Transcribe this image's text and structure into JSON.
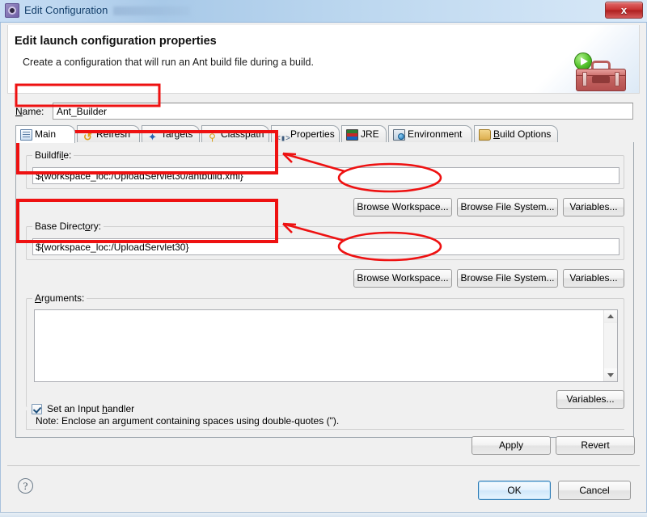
{
  "window": {
    "title": "Edit Configuration",
    "icon": "gear-window-icon",
    "close_label": "x"
  },
  "banner": {
    "title": "Edit launch configuration properties",
    "subtitle": "Create a configuration that will run an Ant build file during a build.",
    "icon": "toolbox-with-run-badge-icon"
  },
  "name": {
    "label": "Name:",
    "value": "Ant_Builder"
  },
  "tabs": [
    {
      "label": "Main",
      "icon": "main-tab-icon",
      "selected": true
    },
    {
      "label": "Refresh",
      "icon": "refresh-tab-icon",
      "selected": false
    },
    {
      "label": "Targets",
      "icon": "targets-tab-icon",
      "selected": false
    },
    {
      "label": "Classpath",
      "icon": "classpath-tab-icon",
      "selected": false
    },
    {
      "label": "Properties",
      "icon": "properties-tab-icon",
      "selected": false
    },
    {
      "label": "JRE",
      "icon": "jre-tab-icon",
      "selected": false
    },
    {
      "label": "Environment",
      "icon": "environment-tab-icon",
      "selected": false
    },
    {
      "label": "Build Options",
      "icon": "build-options-tab-icon",
      "selected": false
    }
  ],
  "buildfile": {
    "group_label": "Buildfile:",
    "value": "${workspace_loc:/UploadServlet30/antbuild.xml}",
    "browse_workspace_label": "Browse Workspace...",
    "browse_file_system_label": "Browse File System...",
    "variables_label": "Variables..."
  },
  "base_directory": {
    "group_label": "Base Directory:",
    "value": "${workspace_loc:/UploadServlet30}",
    "browse_workspace_label": "Browse Workspace...",
    "browse_file_system_label": "Browse File System...",
    "variables_label": "Variables..."
  },
  "arguments": {
    "group_label": "Arguments:",
    "value": "",
    "variables_label": "Variables...",
    "note": "Note: Enclose an argument containing spaces using double-quotes (\")."
  },
  "input_handler": {
    "label": "Set an Input handler",
    "checked": true
  },
  "footer": {
    "apply_label": "Apply",
    "revert_label": "Revert",
    "ok_label": "OK",
    "cancel_label": "Cancel",
    "help_glyph": "?"
  },
  "annotations": {
    "color": "#ee1111",
    "highlight_boxes": [
      "name-field",
      "buildfile-group",
      "base-directory-group"
    ],
    "ellipses": [
      "buildfile-browse-workspace-button",
      "base-directory-browse-workspace-button"
    ],
    "arrows": 2
  }
}
